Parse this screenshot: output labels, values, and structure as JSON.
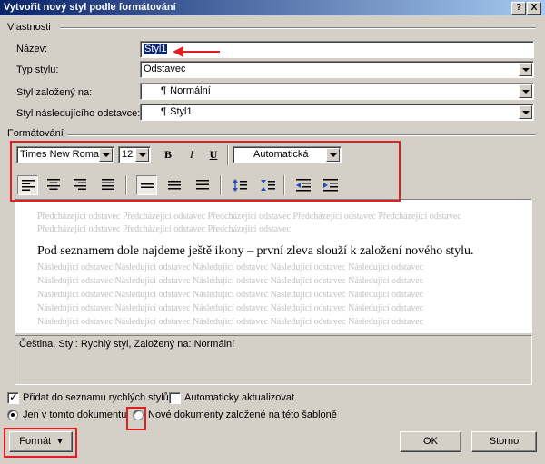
{
  "window": {
    "title": "Vytvořit nový styl podle formátování",
    "help_label": "?",
    "close_label": "X"
  },
  "properties": {
    "section_label": "Vlastnosti",
    "name_label": "Název:",
    "name_value": "Styl1",
    "type_label": "Typ stylu:",
    "type_value": "Odstavec",
    "based_on_label": "Styl založený na:",
    "based_on_value": "Normální",
    "next_style_label": "Styl následujícího odstavce:",
    "next_style_value": "Styl1",
    "pilcrow": "¶"
  },
  "formatting": {
    "section_label": "Formátování",
    "font_name": "Times New Roman",
    "font_size": "12",
    "bold_label": "B",
    "italic_label": "I",
    "underline_label": "U",
    "color_value": "Automatická"
  },
  "preview": {
    "previous_lines": [
      "Předcházející odstavec Předcházející odstavec Předcházející odstavec Předcházející odstavec Předcházející odstavec",
      "Předcházející odstavec Předcházející odstavec Předcházející odstavec"
    ],
    "main_text": "Pod seznamem dole najdeme ještě ikony – první zleva slouží k založení nového stylu.",
    "following_lines": [
      "Následující odstavec Následující odstavec Následující odstavec Následující odstavec Následující odstavec",
      "Následující odstavec Následující odstavec Následující odstavec Následující odstavec Následující odstavec",
      "Následující odstavec Následující odstavec Následující odstavec Následující odstavec Následující odstavec",
      "Následující odstavec Následující odstavec Následující odstavec Následující odstavec Následující odstavec",
      "Následující odstavec Následující odstavec Následující odstavec Následující odstavec Následující odstavec"
    ]
  },
  "description": "Čeština, Styl: Rychlý styl, Založený na: Normální",
  "options": {
    "add_quick_styles_label": "Přidat do seznamu rychlých stylů",
    "add_quick_styles_checked": true,
    "auto_update_label": "Automaticky aktualizovat",
    "auto_update_checked": false,
    "only_this_doc_label": "Jen v tomto dokumentu",
    "only_this_doc_selected": true,
    "new_docs_template_label": "Nové dokumenty založené na této šabloně",
    "new_docs_template_selected": false
  },
  "buttons": {
    "format_label": "Formát",
    "format_arrow": "▾",
    "ok_label": "OK",
    "cancel_label": "Storno"
  },
  "colors": {
    "annotation_red": "#e02020",
    "title_bar": "#0a246a",
    "dialog_face": "#d4d0c8"
  }
}
